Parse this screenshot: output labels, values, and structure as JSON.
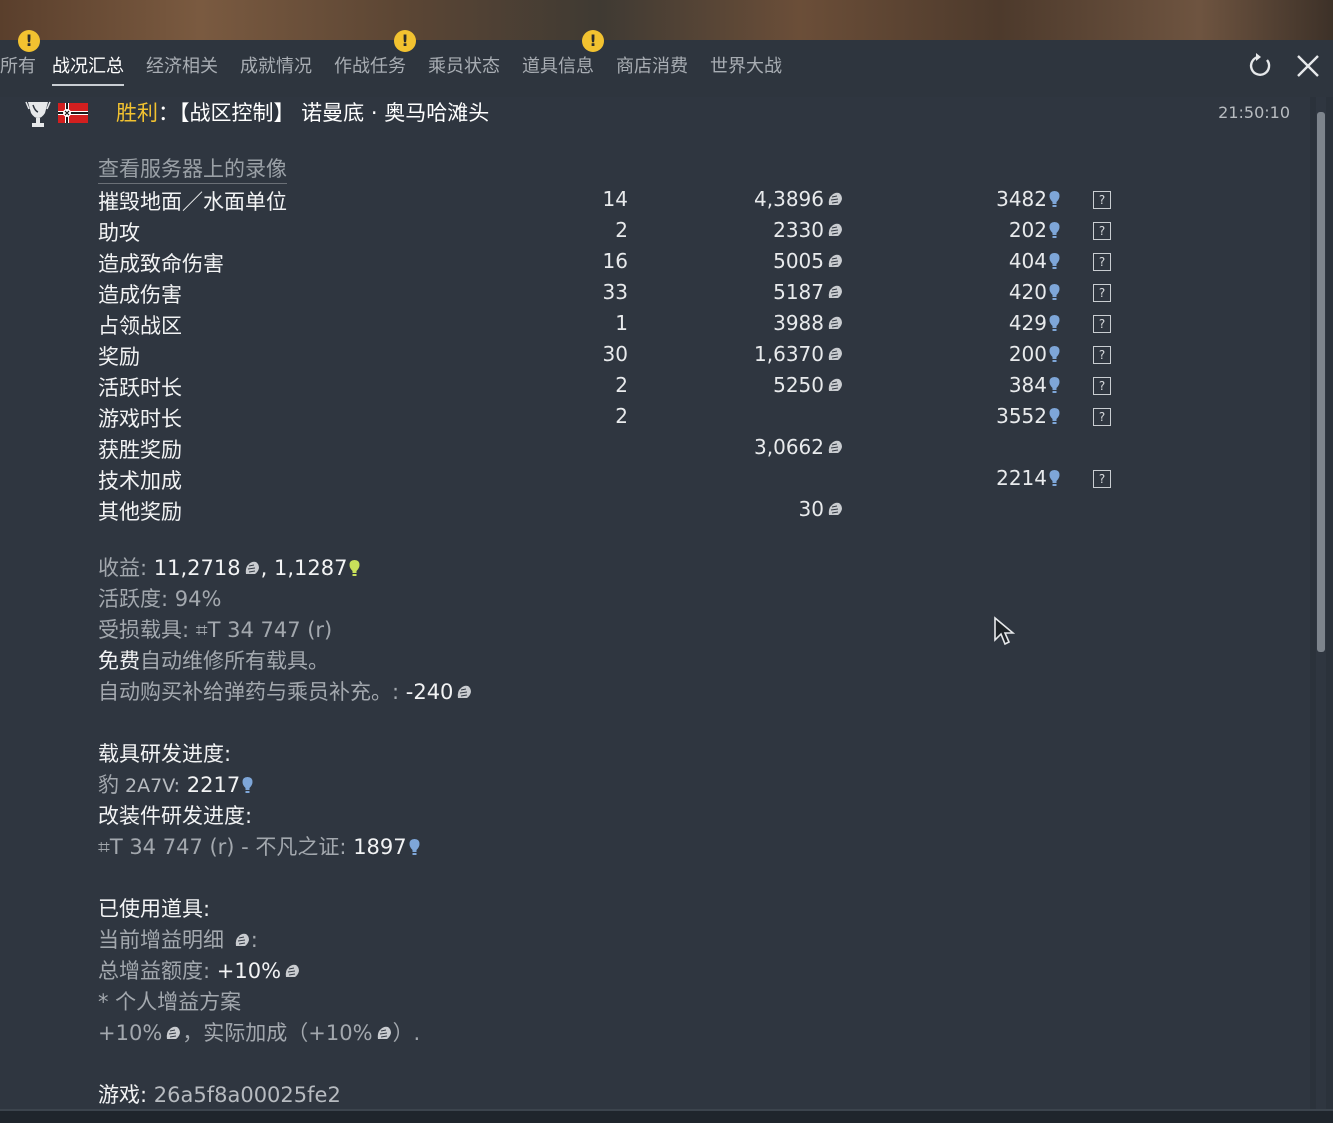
{
  "tabs": [
    {
      "label": "所有",
      "active": false
    },
    {
      "label": "战况汇总",
      "active": true
    },
    {
      "label": "经济相关",
      "active": false
    },
    {
      "label": "成就情况",
      "active": false
    },
    {
      "label": "作战任务",
      "active": false
    },
    {
      "label": "乘员状态",
      "active": false
    },
    {
      "label": "道具信息",
      "active": false
    },
    {
      "label": "商店消费",
      "active": false
    },
    {
      "label": "世界大战",
      "active": false
    }
  ],
  "warning_badge": "!",
  "header": {
    "victory_label": "胜利",
    "title_rest": "：【战区控制】 诺曼底 · 奥马哈滩头",
    "time": "21:50:10"
  },
  "replay_link": "查看服务器上的录像",
  "stats": [
    {
      "label": "摧毁地面／水面单位",
      "count": "14",
      "silver": "4,3896",
      "rp": "3482",
      "help": true
    },
    {
      "label": "助攻",
      "count": "2",
      "silver": "2330",
      "rp": "202",
      "help": true
    },
    {
      "label": "造成致命伤害",
      "count": "16",
      "silver": "5005",
      "rp": "404",
      "help": true
    },
    {
      "label": "造成伤害",
      "count": "33",
      "silver": "5187",
      "rp": "420",
      "help": true
    },
    {
      "label": "占领战区",
      "count": "1",
      "silver": "3988",
      "rp": "429",
      "help": true
    },
    {
      "label": "奖励",
      "count": "30",
      "silver": "1,6370",
      "rp": "200",
      "help": true
    },
    {
      "label": "活跃时长",
      "count": "2",
      "silver": "5250",
      "rp": "384",
      "help": true
    },
    {
      "label": "游戏时长",
      "count": "2",
      "silver": "",
      "rp": "3552",
      "help": true
    },
    {
      "label": "获胜奖励",
      "count": "",
      "silver": "3,0662",
      "rp": "",
      "help": false
    },
    {
      "label": "技术加成",
      "count": "",
      "silver": "",
      "rp": "2214",
      "help": true
    },
    {
      "label": "其他奖励",
      "count": "",
      "silver": "30",
      "rp": "",
      "help": false
    }
  ],
  "help_glyph": "?",
  "summary": {
    "income_label": "收益:",
    "income_silver": " 11,2718",
    "income_sep": ", ",
    "income_rp": "1,1287",
    "activity_label": "活跃度:",
    "activity_value": " 94%",
    "damaged_label": "受损载具:",
    "damaged_value": " ⌗T 34 747 (r)",
    "free_repair_a": "免费",
    "free_repair_b": "自动维修所有载具。",
    "auto_buy_label": "自动购买补给弹药与乘员补充。:",
    "auto_buy_value": " -240"
  },
  "research": {
    "vehicle_title": "载具研发进度:",
    "vehicle_name": "豹",
    "vehicle_model": " 2A7V:",
    "vehicle_rp": " 2217",
    "mod_title": "改装件研发进度:",
    "mod_line": "⌗T 34 747 (r) - 不凡之证:",
    "mod_rp": " 1897"
  },
  "boosters": {
    "title": "已使用道具:",
    "current_label": "当前增益明细",
    "current_colon": ":",
    "total_label": "总增益额度:",
    "total_value": " +10%",
    "personal": "* 个人增益方案",
    "actual_a": "+10%",
    "actual_b": "，实际加成（+10%",
    "actual_c": "）."
  },
  "game": {
    "label": "游戏:",
    "id": " 26a5f8a00025fe2"
  },
  "colors": {
    "victory": "#f2c230",
    "rp_bulb": "#7ea6d8",
    "income_bulb": "#c8e05a",
    "warning": "#f2c230"
  },
  "icons": [
    "refresh-icon",
    "close-icon",
    "cup-icon",
    "flag-icon",
    "lion-icon",
    "bulb-icon",
    "cursor-icon"
  ]
}
